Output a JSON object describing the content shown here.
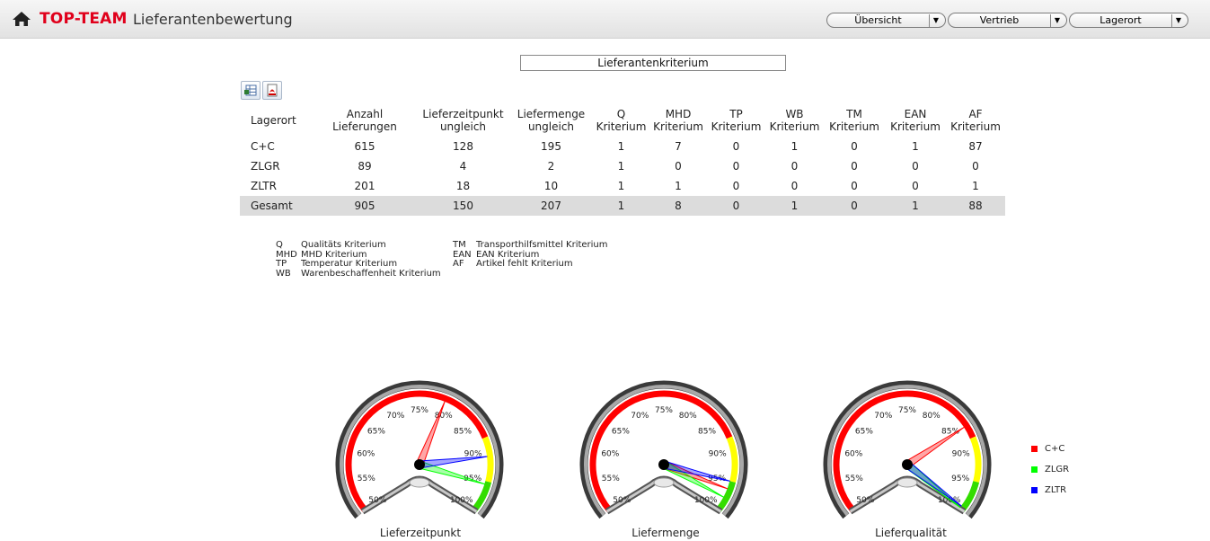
{
  "header": {
    "brand": "TOP-TEAM",
    "title": "Lieferantenbewertung",
    "dropdowns": [
      {
        "label": "Übersicht"
      },
      {
        "label": "Vertrieb"
      },
      {
        "label": "Lagerort"
      }
    ]
  },
  "main": {
    "title": "Lieferantenkriterium",
    "export_icons": [
      "excel-export-icon",
      "pdf-export-icon"
    ],
    "table": {
      "columns": [
        "Lagerort",
        "Anzahl Lieferungen",
        "Lieferzeitpunkt ungleich",
        "Liefermenge ungleich",
        "Q Kriterium",
        "MHD Kriterium",
        "TP Kriterium",
        "WB Kriterium",
        "TM Kriterium",
        "EAN Kriterium",
        "AF Kriterium"
      ],
      "rows": [
        [
          "C+C",
          "615",
          "128",
          "195",
          "1",
          "7",
          "0",
          "1",
          "0",
          "1",
          "87"
        ],
        [
          "ZLGR",
          "89",
          "4",
          "2",
          "1",
          "0",
          "0",
          "0",
          "0",
          "0",
          "0"
        ],
        [
          "ZLTR",
          "201",
          "18",
          "10",
          "1",
          "1",
          "0",
          "0",
          "0",
          "0",
          "1"
        ]
      ],
      "total": [
        "Gesamt",
        "905",
        "150",
        "207",
        "1",
        "8",
        "0",
        "1",
        "0",
        "1",
        "88"
      ]
    },
    "legend_left": [
      {
        "abbr": "Q",
        "text": "Qualitäts Kriterium"
      },
      {
        "abbr": "MHD",
        "text": "MHD Kriterium"
      },
      {
        "abbr": "TP",
        "text": "Temperatur Kriterium"
      },
      {
        "abbr": "WB",
        "text": "Warenbeschaffenheit Kriterium"
      }
    ],
    "legend_right": [
      {
        "abbr": "TM",
        "text": "Transporthilfsmittel Kriterium"
      },
      {
        "abbr": "EAN",
        "text": "EAN Kriterium"
      },
      {
        "abbr": "AF",
        "text": "Artikel fehlt Kriterium"
      }
    ]
  },
  "chart_data": {
    "type": "gauge",
    "scale_labels": [
      "50%",
      "55%",
      "60%",
      "65%",
      "70%",
      "75%",
      "80%",
      "85%",
      "90%",
      "95%",
      "100%"
    ],
    "range": [
      50,
      100
    ],
    "bands": [
      {
        "from": 50,
        "to": 88,
        "color": "#ff0000"
      },
      {
        "from": 88,
        "to": 95,
        "color": "#ffff00"
      },
      {
        "from": 95,
        "to": 100,
        "color": "#33dd00"
      }
    ],
    "series": [
      {
        "name": "C+C",
        "color": "#ff0000"
      },
      {
        "name": "ZLGR",
        "color": "#00ff00"
      },
      {
        "name": "ZLTR",
        "color": "#0000ff"
      }
    ],
    "gauges": [
      {
        "label": "Lieferzeitpunkt",
        "values": [
          79.2,
          95.5,
          91.0
        ]
      },
      {
        "label": "Liefermenge",
        "values": [
          96.3,
          97.8,
          95.0
        ]
      },
      {
        "label": "Lieferqualität",
        "values": [
          85.9,
          99.8,
          99.5
        ]
      }
    ]
  }
}
